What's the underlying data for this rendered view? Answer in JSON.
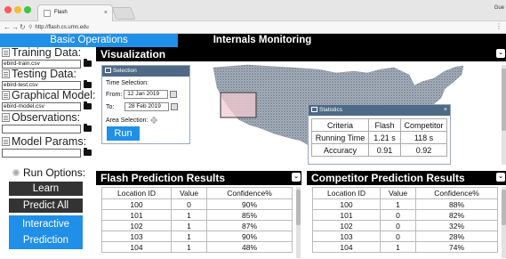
{
  "browser": {
    "tab_title": "Flash",
    "url": "http://flash.cs.umn.edu",
    "corner_text": "Gue",
    "colors": {
      "close": "#fc5b57",
      "minimize": "#f5bd2d",
      "maximize": "#3bc73f"
    }
  },
  "nav": {
    "basic_ops": "Basic Operations",
    "internals": "Internals Monitoring",
    "active_color": "#1f8fe8"
  },
  "left": {
    "training_label": "Training Data:",
    "training_value": "ebird-train.csv",
    "testing_label": "Testing Data:",
    "testing_value": "ebird-test.csv",
    "model_label": "Graphical Model:",
    "model_value": "ebird-model.csv",
    "obs_label": "Observations:",
    "obs_value": "",
    "params_label": "Model Params:",
    "params_value": "",
    "run_options": "Run Options:",
    "learn": "Learn",
    "predict_all": "Predict All",
    "interactive": "Interactive",
    "prediction": "Prediction"
  },
  "viz": {
    "title": "Visualization",
    "selection": {
      "header": "Selection",
      "time_label": "Time Selection:",
      "from_label": "From:",
      "from_value": "12 Jan 2019",
      "to_label": "To:",
      "to_value": "28 Feb 2019",
      "area_label": "Area Selection:",
      "run": "Run"
    },
    "stats": {
      "header": "Statistics",
      "columns": [
        "Criteria",
        "Flash",
        "Competitor"
      ],
      "rows": [
        [
          "Running Time",
          "1.21 s",
          "118 s"
        ],
        [
          "Accuracy",
          "0.91",
          "0.92"
        ]
      ]
    }
  },
  "flash_results": {
    "title": "Flash Prediction Results",
    "columns": [
      "Location ID",
      "Value",
      "Confidence%"
    ],
    "rows": [
      [
        "100",
        "0",
        "90%"
      ],
      [
        "101",
        "1",
        "85%"
      ],
      [
        "102",
        "1",
        "87%"
      ],
      [
        "103",
        "1",
        "90%"
      ],
      [
        "104",
        "1",
        "48%"
      ]
    ]
  },
  "competitor_results": {
    "title": "Competitor Prediction Results",
    "columns": [
      "Location ID",
      "Value",
      "Confidence%"
    ],
    "rows": [
      [
        "100",
        "1",
        "88%"
      ],
      [
        "101",
        "0",
        "82%"
      ],
      [
        "102",
        "0",
        "32%"
      ],
      [
        "103",
        "0",
        "28%"
      ],
      [
        "104",
        "1",
        "74%"
      ]
    ]
  }
}
